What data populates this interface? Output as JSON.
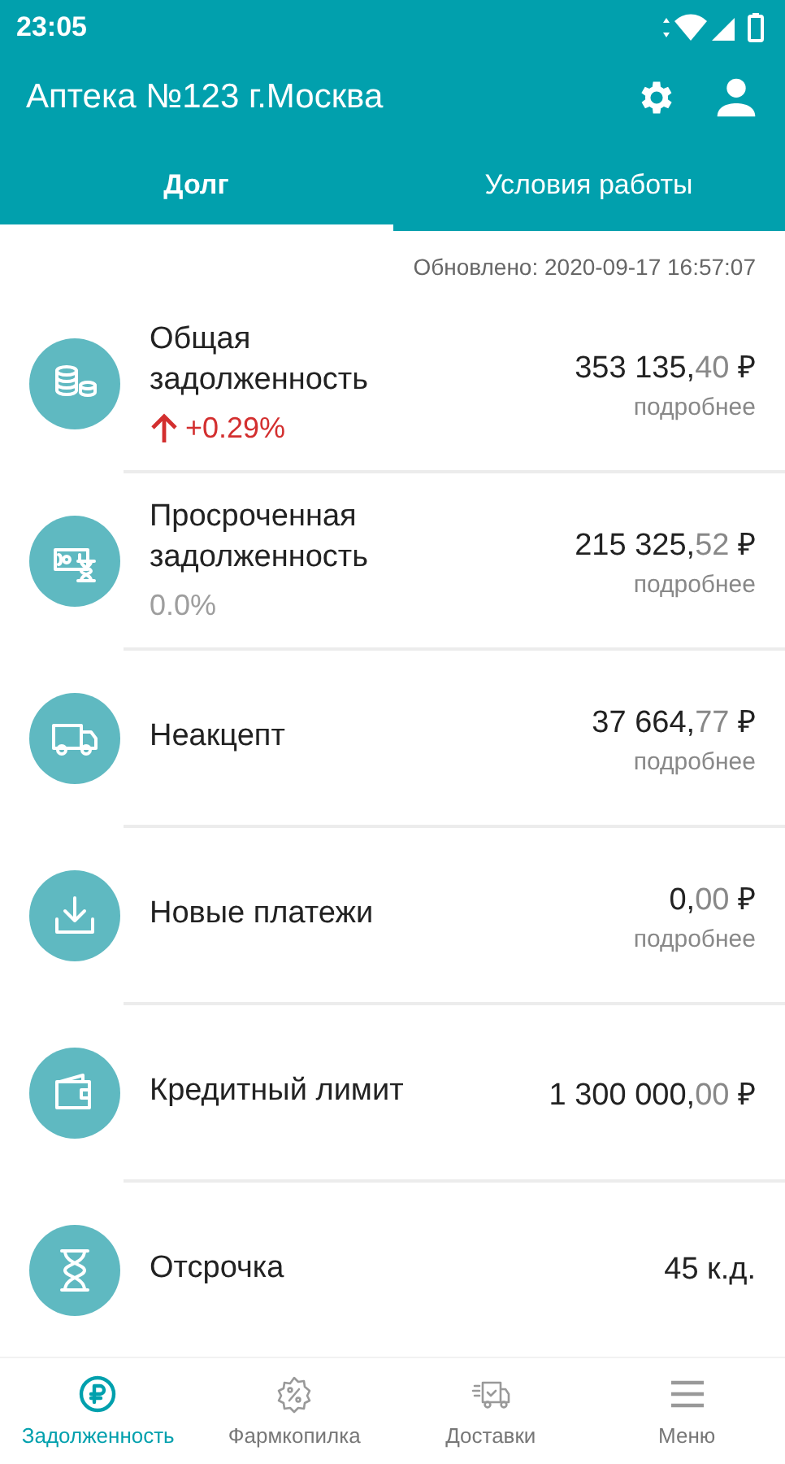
{
  "status_bar": {
    "time": "23:05"
  },
  "app_bar": {
    "title": "Аптека №123 г.Москва"
  },
  "tabs": [
    {
      "label": "Долг",
      "selected": true
    },
    {
      "label": "Условия работы",
      "selected": false
    }
  ],
  "updated": "Обновлено: 2020-09-17 16:57:07",
  "rows": [
    {
      "kind": "coins",
      "title": "Общая задолженность",
      "amount": "353 135,",
      "fraction": "40",
      "currency": "₽",
      "details": "подробнее",
      "change": {
        "text": "+0.29%",
        "kind": "up"
      }
    },
    {
      "kind": "overdue",
      "title": "Просроченная задолженность",
      "amount": "215 325,",
      "fraction": "52",
      "currency": "₽",
      "details": "подробнее",
      "change": {
        "text": "0.0%",
        "kind": "flat"
      }
    },
    {
      "kind": "truck",
      "title": "Неакцепт",
      "amount": "37 664,",
      "fraction": "77",
      "currency": "₽",
      "details": "подробнее"
    },
    {
      "kind": "download",
      "title": "Новые платежи",
      "amount": "0,",
      "fraction": "00",
      "currency": "₽",
      "details": "подробнее"
    },
    {
      "kind": "wallet",
      "title": "Кредитный лимит",
      "amount": "1 300 000,",
      "fraction": "00",
      "currency": "₽"
    },
    {
      "kind": "hourglass",
      "title": "Отсрочка",
      "amount": "45 к.д."
    }
  ],
  "bottom_nav": [
    {
      "kind": "ruble",
      "label": "Задолженность",
      "selected": true
    },
    {
      "kind": "percent",
      "label": "Фармкопилка",
      "selected": false
    },
    {
      "kind": "delivery",
      "label": "Доставки",
      "selected": false
    },
    {
      "kind": "menu",
      "label": "Меню",
      "selected": false
    }
  ]
}
